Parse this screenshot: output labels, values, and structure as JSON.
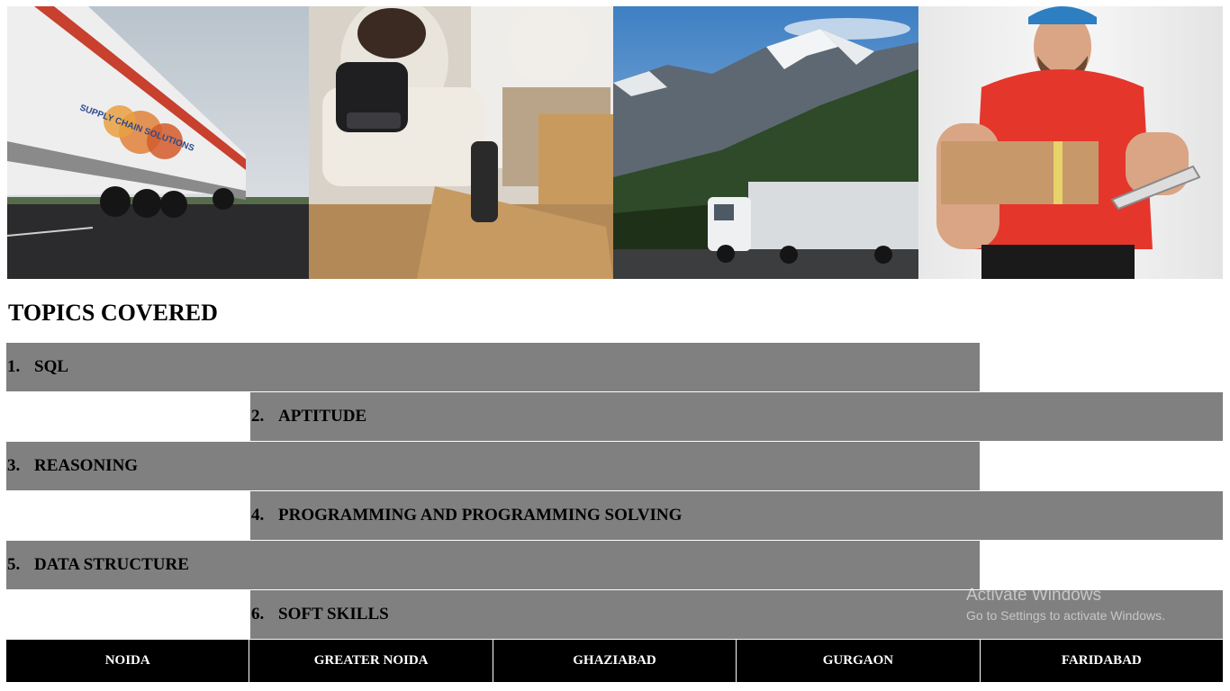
{
  "banner": {
    "images": [
      {
        "name": "truck-highway-photo",
        "logo_text": "SUPPLY CHAIN SOLUTIONS"
      },
      {
        "name": "barcode-scanner-photo"
      },
      {
        "name": "mountain-truck-photo"
      },
      {
        "name": "delivery-man-photo"
      }
    ]
  },
  "page": {
    "heading": "TOPICS COVERED"
  },
  "topics": [
    {
      "num": "1.",
      "label": "SQL"
    },
    {
      "num": "2.",
      "label": "APTITUDE"
    },
    {
      "num": "3.",
      "label": "REASONING"
    },
    {
      "num": "4.",
      "label": "PROGRAMMING AND PROGRAMMING SOLVING"
    },
    {
      "num": "5.",
      "label": "DATA STRUCTURE"
    },
    {
      "num": "6.",
      "label": "SOFT SKILLS"
    }
  ],
  "watermark": {
    "line1": "Activate Windows",
    "line2": "Go to Settings to activate Windows."
  },
  "footer": {
    "cities": [
      "NOIDA",
      "GREATER NOIDA",
      "GHAZIABAD",
      "GURGAON",
      "FARIDABAD"
    ]
  },
  "colors": {
    "topic_bar": "#808080",
    "footer_bg": "#000000",
    "footer_text": "#ffffff"
  }
}
